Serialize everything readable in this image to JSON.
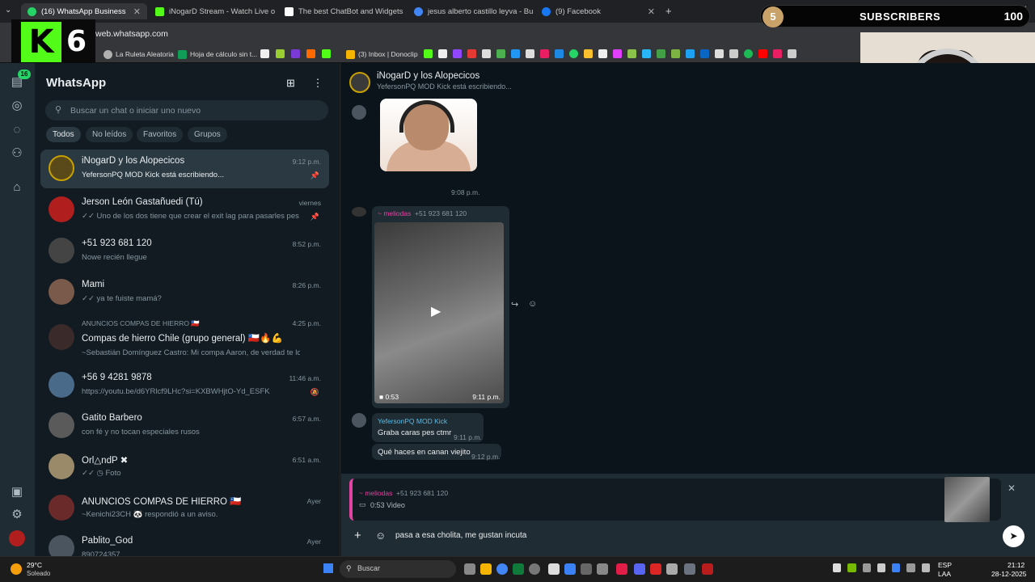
{
  "browser": {
    "tabs": [
      {
        "label": "(16) WhatsApp Business",
        "color": "#25d366",
        "active": true
      },
      {
        "label": "iNogarD Stream - Watch Live o",
        "color": "#53fc18"
      },
      {
        "label": "The best ChatBot and Widgets",
        "color": "#ffffff"
      },
      {
        "label": "jesus alberto castillo leyva - Bu",
        "color": "#4285f4"
      },
      {
        "label": "(9) Facebook",
        "color": "#1877f2"
      }
    ],
    "url": "web.whatsapp.com",
    "bookmarks": [
      {
        "label": "La Ruleta Aleatoria",
        "color": "#b0b0b0"
      },
      {
        "label": "Hoja de cálculo sin t...",
        "color": "#0f9d58"
      },
      {
        "label": "(3) Inbox | Donoclip",
        "color": "#f4b400"
      }
    ]
  },
  "overlay": {
    "logo_text": "6",
    "subs_badge": "5",
    "subs_label": "SUBSCRIBERS",
    "subs_count": "100"
  },
  "app": {
    "title": "WhatsApp",
    "rail_badge": "16",
    "search_placeholder": "Buscar un chat o iniciar uno nuevo",
    "filters": [
      "Todos",
      "No leídos",
      "Favoritos",
      "Grupos"
    ]
  },
  "chats": [
    {
      "name": "iNogarD y los Alopecicos",
      "preview": "YefersonPQ MOD Kick está escribiendo...",
      "time": "9:12 p.m.",
      "icon": "pin-icon",
      "selected": true,
      "avatar": "#5a4a1a"
    },
    {
      "name": "Jerson León Gastañuedi (Tú)",
      "preview": "✓✓ Uno de los dos tiene que crear el exit lag para pasarles pes",
      "time": "viernes",
      "icon": "pin-icon",
      "avatar": "#b01e1e"
    },
    {
      "name": "+51 923 681 120",
      "preview": "Nowe recién llegue",
      "time": "8:52 p.m.",
      "avatar": "#444444"
    },
    {
      "name": "Mami",
      "preview": "✓✓ ya te fuiste mamá?",
      "time": "8:26 p.m.",
      "avatar": "#7a5a4a"
    },
    {
      "name": "Compas de hierro Chile (grupo general) 🇨🇱🔥💪",
      "group_label": "ANUNCIOS COMPAS DE HIERRO 🇨🇱",
      "preview": "~Sebastián Domínguez Castro: Mi compa Aaron, de verdad te lo agra...",
      "time": "4:25 p.m.",
      "avatar": "#3a2a2a"
    },
    {
      "name": "+56 9 4281 9878",
      "preview": "https://youtu.be/d6YRlcf9LHc?si=KXBWHjtO-Yd_ESFK",
      "time": "11:46 a.m.",
      "icon": "mute-icon",
      "avatar": "#4a6a8a"
    },
    {
      "name": "Gatito Barbero",
      "preview": "con fé y no tocan especiales rusos",
      "time": "6:57 a.m.",
      "avatar": "#5a5a5a"
    },
    {
      "name": "Orl△ndP ✖",
      "preview": "✓✓ ◷ Foto",
      "time": "6:51 a.m.",
      "avatar": "#9a8a6a"
    },
    {
      "name": "ANUNCIOS COMPAS DE HIERRO 🇨🇱",
      "preview": "~Kenichi23CH 🐼 respondió a un aviso.",
      "time": "Ayer",
      "avatar": "#6a2a2a"
    },
    {
      "name": "Pablito_God",
      "preview": "890724357",
      "time": "Ayer",
      "avatar": "#4a5560"
    }
  ],
  "conversation": {
    "title": "iNogarD y los Alopecicos",
    "subtitle": "YefersonPQ MOD Kick está escribiendo...",
    "sticker_time": "9:08 p.m.",
    "video_author": "~ meliodas",
    "video_author_phone": "+51 923 681 120",
    "video_duration": "0:53",
    "video_time": "9:11 p.m.",
    "msg_author": "YefersonPQ MOD Kick",
    "msg1": "Graba caras pes ctmr",
    "msg1_time": "9:11 p.m.",
    "msg2": "Qué haces en canan viejito",
    "msg2_time": "9:12 p.m.",
    "reply_author": "~ meliodas",
    "reply_phone": "+51 923 681 120",
    "reply_kind": "0:53 Video",
    "input_value": "pasa a esa cholita, me gustan incuta"
  },
  "taskbar": {
    "weather_temp": "29°C",
    "weather_desc": "Soleado",
    "search": "Buscar",
    "lang1": "ESP",
    "lang2": "LAA",
    "clock_time": "21:12",
    "clock_date": "28-12-2025"
  },
  "colors": {
    "accent": "#25d366",
    "author_pink": "#e542a3",
    "author_green": "#53bdeb"
  }
}
